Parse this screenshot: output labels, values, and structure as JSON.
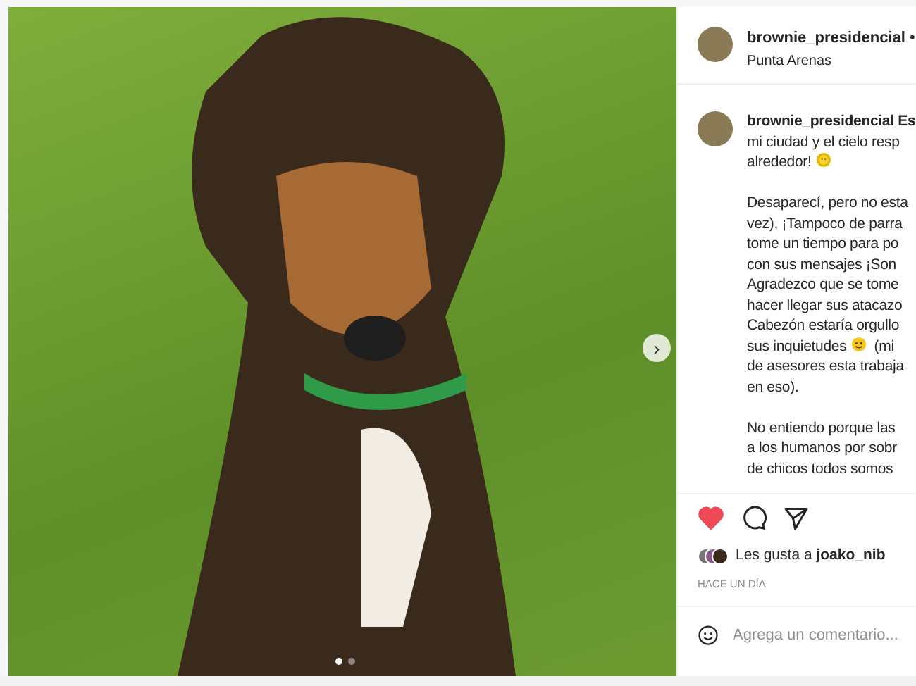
{
  "photo": {
    "next_button": "›",
    "dots": [
      {
        "selected": true
      },
      {
        "selected": false
      }
    ]
  },
  "header": {
    "username": "brownie_presidencial",
    "separator": "•",
    "location": "Punta Arenas"
  },
  "caption": {
    "username": "brownie_presidencial",
    "lines": [
      {
        "text": "Es",
        "kind": "lead"
      },
      {
        "text": "mi ciudad y el cielo resp",
        "kind": "plain"
      },
      {
        "text": "alrededor!",
        "kind": "sun"
      },
      {
        "kind": "gap"
      },
      {
        "text": "Desaparecí, pero no esta",
        "kind": "plain"
      },
      {
        "text": "vez), ¡Tampoco de parra",
        "kind": "plain"
      },
      {
        "text": "tome un tiempo para po",
        "kind": "plain"
      },
      {
        "text": "con sus mensajes ¡Son",
        "kind": "plain"
      },
      {
        "text": "Agradezco que se tome",
        "kind": "plain"
      },
      {
        "text": "hacer llegar sus atacazo",
        "kind": "plain"
      },
      {
        "text": "Cabezón estaría orgullo",
        "kind": "plain"
      },
      {
        "text": "sus inquietudes",
        "kind": "wink",
        "after": "(mi"
      },
      {
        "text": "de asesores esta trabaja",
        "kind": "plain"
      },
      {
        "text": "en eso).",
        "kind": "plain"
      },
      {
        "kind": "gap"
      },
      {
        "text": "No entiendo porque las",
        "kind": "plain"
      },
      {
        "text": "a los humanos por sobr",
        "kind": "plain"
      },
      {
        "text": "de chicos todos somos",
        "kind": "plain"
      }
    ]
  },
  "actions": {
    "liked": true
  },
  "likes": {
    "prefix": "Les gusta a",
    "user": "joako_nib"
  },
  "time": "HACE UN DÍA",
  "comment": {
    "placeholder": "Agrega un comentario..."
  }
}
